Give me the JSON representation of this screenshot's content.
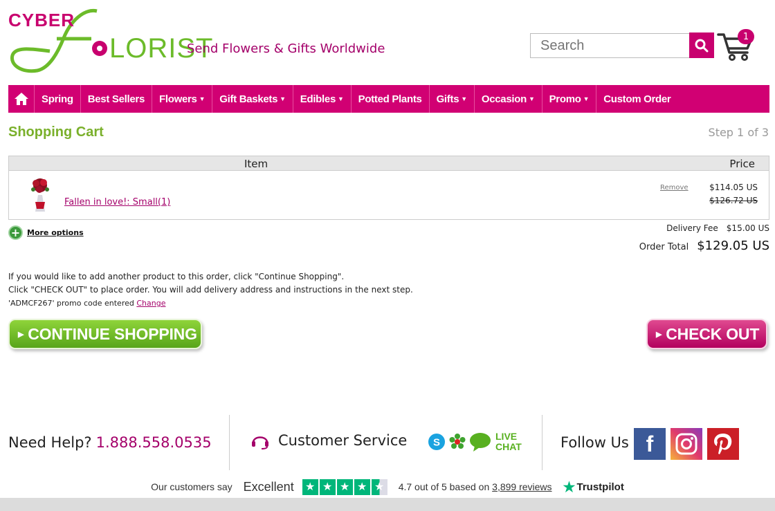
{
  "header": {
    "logo_top": "CYBER",
    "logo_bottom": "LORIST",
    "tagline": "Send Flowers & Gifts Worldwide",
    "search_placeholder": "Search",
    "cart_count": "1"
  },
  "nav": {
    "items": [
      {
        "label": "Spring",
        "dropdown": false
      },
      {
        "label": "Best Sellers",
        "dropdown": false
      },
      {
        "label": "Flowers",
        "dropdown": true
      },
      {
        "label": "Gift Baskets",
        "dropdown": true
      },
      {
        "label": "Edibles",
        "dropdown": true
      },
      {
        "label": "Potted Plants",
        "dropdown": false
      },
      {
        "label": "Gifts",
        "dropdown": true
      },
      {
        "label": "Occasion",
        "dropdown": true
      },
      {
        "label": "Promo",
        "dropdown": true
      },
      {
        "label": "Custom Order",
        "dropdown": false
      }
    ],
    "caret": "▼"
  },
  "page": {
    "title": "Shopping Cart",
    "step": "Step 1 of 3"
  },
  "cart": {
    "header_item": "Item",
    "header_price": "Price",
    "item_name": "Fallen in love!: Small(1)",
    "remove": "Remove",
    "price": "$114.05 US",
    "original_price": "$126.72 US",
    "more_options": "More options",
    "delivery_fee_label": "Delivery Fee",
    "delivery_fee": "$15.00 US",
    "order_total_label": "Order Total",
    "order_total": "$129.05 US"
  },
  "messages": {
    "line1": "If you would like to add another product to this order, click \"Continue Shopping\".",
    "line2": "Click \"CHECK OUT\" to place order. You will add delivery address and instructions in the next step.",
    "promo": "'ADMCF267' promo code entered ",
    "change": "Change"
  },
  "buttons": {
    "continue": "CONTINUE SHOPPING",
    "checkout": "CHECK OUT"
  },
  "footer": {
    "need_help": "Need Help?",
    "phone": "1.888.558.0535",
    "customer_service": "Customer Service",
    "live_chat_line1": "LIVE",
    "live_chat_line2": "CHAT",
    "follow_us": "Follow Us",
    "facebook": "f"
  },
  "trustpilot": {
    "customers_say": "Our customers say",
    "rating_word": "Excellent",
    "rating": 4.7,
    "rating_text_before": "4.7 out of 5 based on ",
    "reviews": "3,899 reviews",
    "brand": "Trustpilot"
  },
  "colors": {
    "brand_pink": "#c8006e",
    "nav_pink": "#d10073",
    "brand_green": "#6cbb2a",
    "trust_green": "#00b67a"
  }
}
